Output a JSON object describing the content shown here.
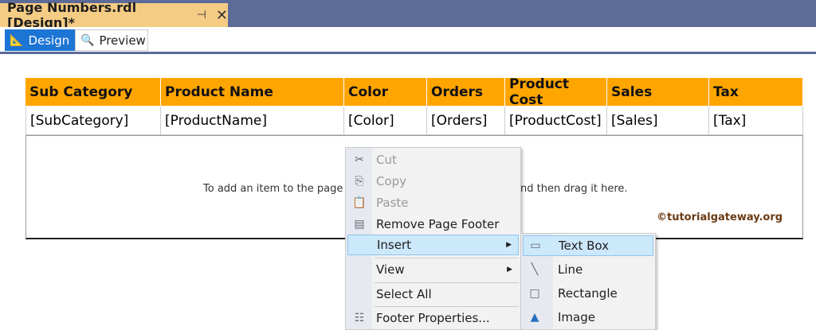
{
  "document_tab": {
    "title": "Page Numbers.rdl [Design]*",
    "pin_icon": "pin-icon",
    "close_icon": "close-icon"
  },
  "view_tabs": [
    {
      "label": "Design",
      "icon": "design-ruler-icon"
    },
    {
      "label": "Preview",
      "icon": "preview-icon"
    }
  ],
  "table": {
    "headers": [
      "Sub Category",
      "Product Name",
      "Color",
      "Orders",
      "Product Cost",
      "Sales",
      "Tax"
    ],
    "row": [
      "[SubCategory]",
      "[ProductName]",
      "[Color]",
      "[Orders]",
      "[ProductCost]",
      "[Sales]",
      "[Tax]"
    ],
    "header_color": "#ffa500"
  },
  "footer": {
    "hint_left": "To add an item to the page",
    "hint_right": "nd then drag it here.",
    "watermark": "©tutorialgateway.org"
  },
  "context_menu": {
    "items": [
      {
        "label": "Cut",
        "enabled": false
      },
      {
        "label": "Copy",
        "enabled": false
      },
      {
        "label": "Paste",
        "enabled": false
      },
      {
        "label": "Remove Page Footer",
        "enabled": true
      },
      {
        "label": "Insert",
        "enabled": true,
        "highlighted": true
      },
      {
        "label": "View",
        "enabled": true
      },
      {
        "label": "Select All",
        "enabled": true
      },
      {
        "label": "Footer Properties...",
        "enabled": true
      }
    ]
  },
  "insert_submenu": {
    "items": [
      {
        "label": "Text Box",
        "highlighted": true
      },
      {
        "label": "Line"
      },
      {
        "label": "Rectangle"
      },
      {
        "label": "Image"
      }
    ]
  }
}
